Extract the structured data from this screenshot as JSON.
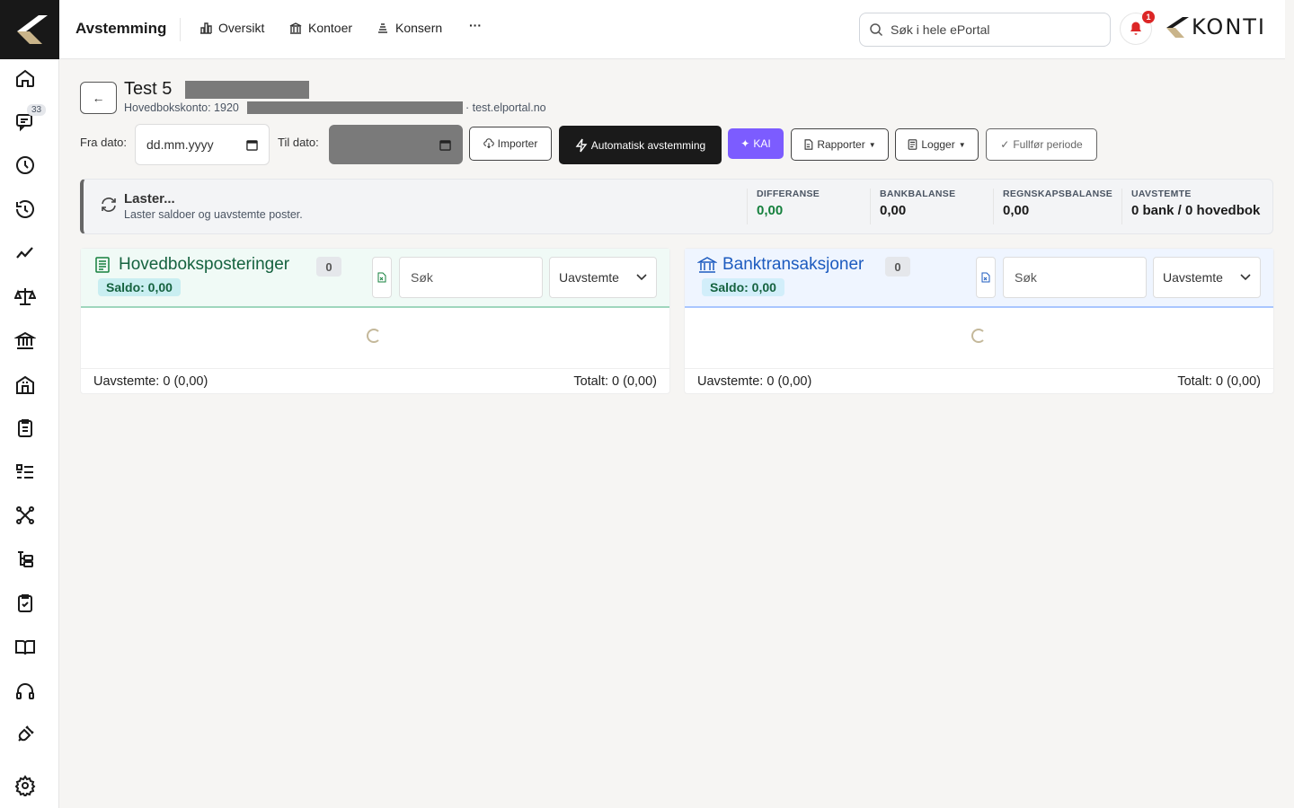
{
  "topbar": {
    "title": "Avstemming",
    "nav": [
      {
        "label": "Oversikt",
        "icon": "chart-bar-icon"
      },
      {
        "label": "Kontoer",
        "icon": "bank-icon"
      },
      {
        "label": "Konsern",
        "icon": "stack-icon"
      }
    ],
    "more_label": "···",
    "search_placeholder": "Søk i hele ePortal",
    "notifications_count": "1",
    "logo_text": "KONTI"
  },
  "sidebar": {
    "badge": "33",
    "items": [
      {
        "icon": "home-icon"
      },
      {
        "icon": "messages-icon"
      },
      {
        "icon": "clock-icon"
      },
      {
        "icon": "history-icon"
      },
      {
        "icon": "trend-icon"
      },
      {
        "icon": "scale-icon"
      },
      {
        "icon": "bank-icon"
      },
      {
        "icon": "building-icon"
      },
      {
        "icon": "clipboard-list-icon"
      },
      {
        "icon": "list-icon"
      },
      {
        "icon": "network-icon"
      },
      {
        "icon": "hierarchy-icon"
      },
      {
        "icon": "clipboard-check-icon"
      },
      {
        "icon": "book-icon"
      },
      {
        "icon": "headset-icon"
      },
      {
        "icon": "plug-icon"
      },
      {
        "icon": "settings-icon"
      }
    ]
  },
  "account": {
    "name": "Test 5",
    "ledger_prefix": "Hovedbokskonto: 1920",
    "domain": "· test.elportal.no"
  },
  "filters": {
    "from_label": "Fra dato:",
    "from_placeholder": "dd.mm.yyyy",
    "to_label": "Til dato:"
  },
  "actions": {
    "import": "Importer",
    "auto": "Automatisk avstemming",
    "kai": "KAI",
    "reports": "Rapporter",
    "logs": "Logger",
    "finish": "Fullfør periode"
  },
  "status": {
    "title": "Laster...",
    "text": "Laster saldoer og uavstemte poster.",
    "metrics": [
      {
        "label": "DIFFERANSE",
        "value": "0,00"
      },
      {
        "label": "BANKBALANSE",
        "value": "0,00"
      },
      {
        "label": "REGNSKAPSBALANSE",
        "value": "0,00"
      },
      {
        "label": "UAVSTEMTE",
        "value": "0 bank / 0 hovedbok"
      }
    ],
    "accent_color": "#15803d"
  },
  "panels": {
    "ledger": {
      "title": "Hovedboksposteringer",
      "count": "0",
      "saldo": "Saldo: 0,00",
      "search_placeholder": "Søk",
      "filter": "Uavstemte",
      "unreconciled": "Uavstemte: 0 (0,00)",
      "total": "Totalt: 0 (0,00)"
    },
    "bank": {
      "title": "Banktransaksjoner",
      "count": "0",
      "saldo": "Saldo: 0,00",
      "search_placeholder": "Søk",
      "filter": "Uavstemte",
      "unreconciled": "Uavstemte: 0 (0,00)",
      "total": "Totalt: 0 (0,00)"
    }
  }
}
